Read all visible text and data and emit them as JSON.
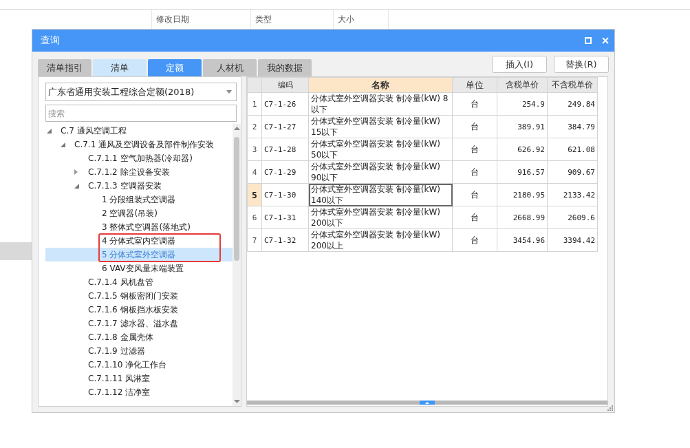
{
  "background": {
    "columns": [
      "修改日期",
      "类型",
      "大小"
    ]
  },
  "dialog": {
    "title": "查询",
    "tabs": [
      {
        "label": "清单指引",
        "selected": false,
        "hover": false
      },
      {
        "label": "清单",
        "selected": false,
        "hover": true
      },
      {
        "label": "定额",
        "selected": true,
        "hover": false
      },
      {
        "label": "人材机",
        "selected": false,
        "hover": false
      },
      {
        "label": "我的数据",
        "selected": false,
        "hover": false
      }
    ],
    "buttons": [
      "插入(I)",
      "替换(R)"
    ],
    "library": {
      "value": "广东省通用安装工程综合定额(2018)"
    },
    "search": {
      "placeholder": "搜索"
    },
    "tree": [
      {
        "label": "C.7 通风空调工程",
        "selected": false,
        "expanded": true,
        "children": [
          {
            "label": "C.7.1 通风及空调设备及部件制作安装",
            "selected": false,
            "expanded": true,
            "children": [
              {
                "label": "C.7.1.1 空气加热器(冷却器)",
                "selected": false
              },
              {
                "label": "C.7.1.2 除尘设备安装",
                "selected": false,
                "expanded": false
              },
              {
                "label": "C.7.1.3 空调器安装",
                "selected": false,
                "expanded": true,
                "children": [
                  {
                    "label": "1 分段组装式空调器",
                    "selected": false
                  },
                  {
                    "label": "2 空调器(吊装)",
                    "selected": false
                  },
                  {
                    "label": "3 整体式空调器(落地式)",
                    "selected": false
                  },
                  {
                    "label": "4 分体式室内空调器",
                    "selected": false
                  },
                  {
                    "label": "5 分体式室外空调器",
                    "selected": true
                  },
                  {
                    "label": "6 VAV变风量末端装置",
                    "selected": false
                  }
                ]
              },
              {
                "label": "C.7.1.4 风机盘管",
                "selected": false
              },
              {
                "label": "C.7.1.5 钢板密闭门安装",
                "selected": false
              },
              {
                "label": "C.7.1.6 钢板挡水板安装",
                "selected": false
              },
              {
                "label": "C.7.1.7 滤水器、溢水盘",
                "selected": false
              },
              {
                "label": "C.7.1.8 金属壳体",
                "selected": false
              },
              {
                "label": "C.7.1.9 过滤器",
                "selected": false
              },
              {
                "label": "C.7.1.10 净化工作台",
                "selected": false
              },
              {
                "label": "C.7.1.11 风淋室",
                "selected": false
              },
              {
                "label": "C.7.1.12 洁净室",
                "selected": false
              }
            ]
          }
        ]
      }
    ],
    "table": {
      "columns": [
        {
          "label": "编码",
          "selected": false
        },
        {
          "label": "名称",
          "selected": true
        },
        {
          "label": "单位",
          "selected": false
        },
        {
          "label": "含税单价",
          "selected": false
        },
        {
          "label": "不含税单价",
          "selected": false
        }
      ],
      "rows": [
        {
          "index": "1",
          "code": "C7-1-26",
          "name": "分体式室外空调器安装 制冷量(kW) 8以下",
          "unit": "台",
          "tax_price": "254.9",
          "price": "249.84",
          "selected": false
        },
        {
          "index": "2",
          "code": "C7-1-27",
          "name": "分体式室外空调器安装 制冷量(kW) 15以下",
          "unit": "台",
          "tax_price": "389.91",
          "price": "384.79",
          "selected": false
        },
        {
          "index": "3",
          "code": "C7-1-28",
          "name": "分体式室外空调器安装 制冷量(kW) 50以下",
          "unit": "台",
          "tax_price": "626.92",
          "price": "621.08",
          "selected": false
        },
        {
          "index": "4",
          "code": "C7-1-29",
          "name": "分体式室外空调器安装 制冷量(kW) 90以下",
          "unit": "台",
          "tax_price": "916.57",
          "price": "909.67",
          "selected": false
        },
        {
          "index": "5",
          "code": "C7-1-30",
          "name": "分体式室外空调器安装 制冷量(kW) 140以下",
          "unit": "台",
          "tax_price": "2180.95",
          "price": "2133.42",
          "selected": true
        },
        {
          "index": "6",
          "code": "C7-1-31",
          "name": "分体式室外空调器安装 制冷量(kW) 200以下",
          "unit": "台",
          "tax_price": "2668.99",
          "price": "2609.6",
          "selected": false
        },
        {
          "index": "7",
          "code": "C7-1-32",
          "name": "分体式室外空调器安装 制冷量(kW) 200以上",
          "unit": "台",
          "tax_price": "3454.96",
          "price": "3394.42",
          "selected": false
        }
      ]
    }
  }
}
